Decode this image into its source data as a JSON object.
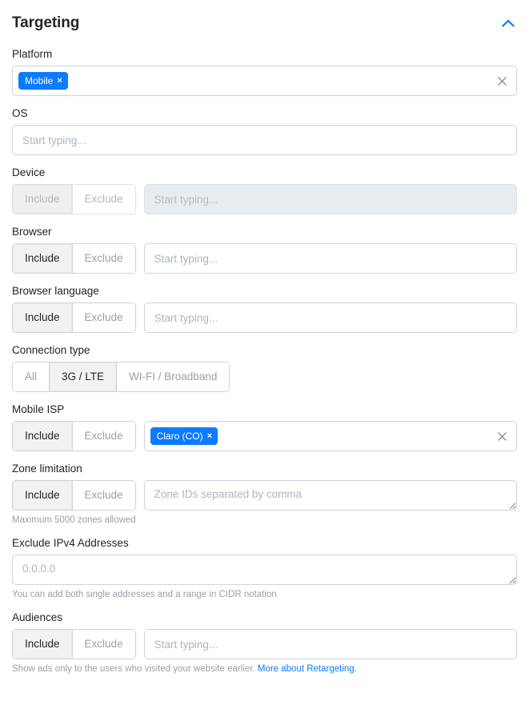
{
  "header": {
    "title": "Targeting",
    "collapse_icon": "chevron-up-icon",
    "accent_color": "#0d7bff"
  },
  "fields": {
    "platform": {
      "label": "Platform",
      "chips": [
        {
          "label": "Mobile",
          "remove": "×"
        }
      ],
      "clear_icon": "×"
    },
    "os": {
      "label": "OS",
      "placeholder": "Start typing...",
      "value": ""
    },
    "device": {
      "label": "Device",
      "include_label": "Include",
      "exclude_label": "Exclude",
      "selected": "Include",
      "disabled": true,
      "placeholder": "Start typing...",
      "value": ""
    },
    "browser": {
      "label": "Browser",
      "include_label": "Include",
      "exclude_label": "Exclude",
      "selected": "Include",
      "placeholder": "Start typing...",
      "value": ""
    },
    "browser_language": {
      "label": "Browser language",
      "include_label": "Include",
      "exclude_label": "Exclude",
      "selected": "Include",
      "placeholder": "Start typing...",
      "value": ""
    },
    "connection_type": {
      "label": "Connection type",
      "options": [
        "All",
        "3G / LTE",
        "WI-FI / Broadband"
      ],
      "selected": "3G / LTE"
    },
    "mobile_isp": {
      "label": "Mobile ISP",
      "include_label": "Include",
      "exclude_label": "Exclude",
      "selected": "Include",
      "chips": [
        {
          "label": "Claro (CO)",
          "remove": "×"
        }
      ],
      "clear_icon": "×"
    },
    "zone_limitation": {
      "label": "Zone limitation",
      "include_label": "Include",
      "exclude_label": "Exclude",
      "selected": "Include",
      "placeholder": "Zone IDs separated by comma",
      "value": "",
      "helper": "Maximum 5000 zones allowed"
    },
    "exclude_ipv4": {
      "label": "Exclude IPv4 Addresses",
      "placeholder": "0.0.0.0",
      "value": "",
      "helper": "You can add both single addresses and a range in CIDR notation"
    },
    "audiences": {
      "label": "Audiences",
      "include_label": "Include",
      "exclude_label": "Exclude",
      "selected": "Include",
      "placeholder": "Start typing...",
      "value": "",
      "helper_text": "Show ads only to the users who visited your website earlier.",
      "helper_link": "More about Retargeting."
    }
  }
}
